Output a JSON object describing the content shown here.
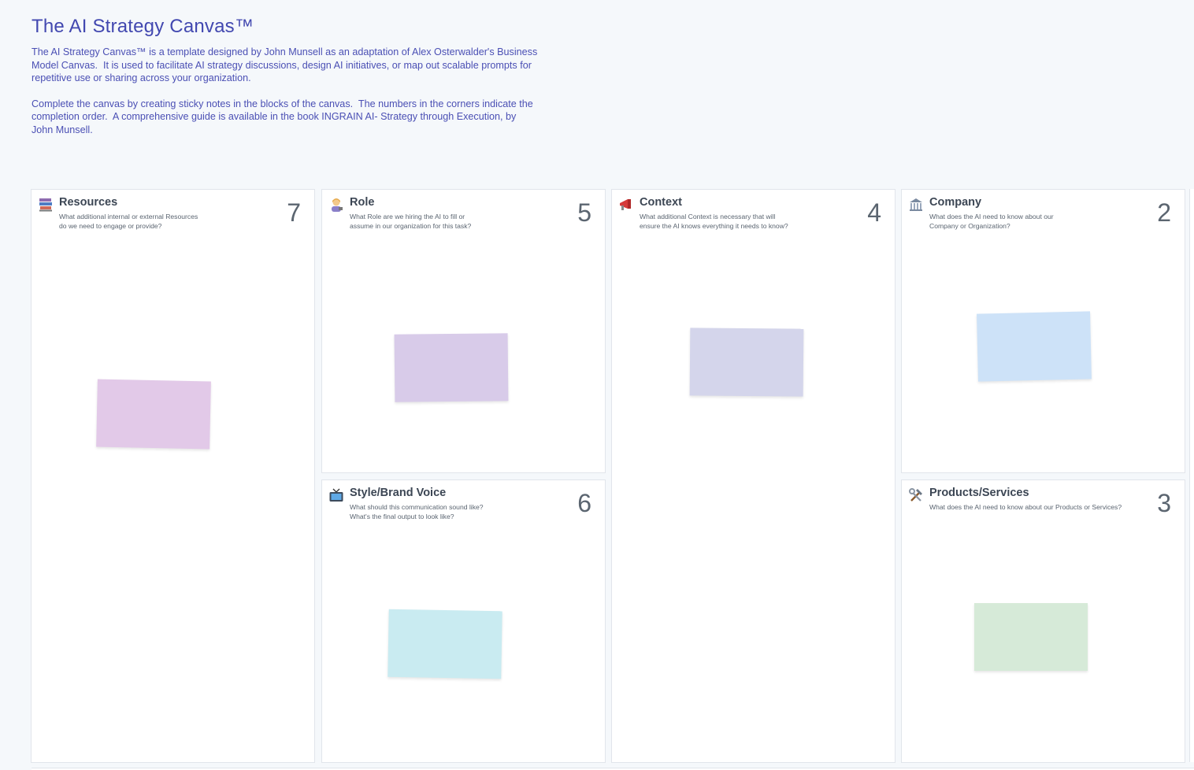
{
  "header": {
    "title": "The AI Strategy Canvas™",
    "paragraph1": "The AI Strategy Canvas™ is a template designed by John Munsell as an adaptation of Alex Osterwalder's Business\nModel Canvas.  It is used to facilitate AI strategy discussions, design AI initiatives, or map out scalable prompts for\nrepetitive use or sharing across your organization.",
    "paragraph2": "Complete the canvas by creating sticky notes in the blocks of the canvas.  The numbers in the corners indicate the\ncompletion order.  A comprehensive guide is available in the book INGRAIN AI- Strategy through Execution, by\nJohn Munsell."
  },
  "blocks": {
    "resources": {
      "title": "Resources",
      "question": "What additional internal or external Resources\ndo we need to engage or provide?",
      "number": "7",
      "icon": "books-icon",
      "note_color": "#e2c9e8"
    },
    "role": {
      "title": "Role",
      "question": "What Role are we hiring the AI to fill or\nassume in our organization for this task?",
      "number": "5",
      "icon": "person-icon",
      "note_color": "#d8cbe9"
    },
    "style": {
      "title": "Style/Brand Voice",
      "question": "What should this communication sound like?\nWhat's the final output to look like?",
      "number": "6",
      "icon": "television-icon",
      "note_color": "#c9ebf1"
    },
    "context": {
      "title": "Context",
      "question": "What additional Context is necessary that will\nensure the AI knows everything it needs to know?",
      "number": "4",
      "icon": "megaphone-icon",
      "note_color": "#d4d5eb"
    },
    "company": {
      "title": "Company",
      "question": "What does the AI need to know about our\nCompany or Organization?",
      "number": "2",
      "icon": "building-icon",
      "note_color": "#cde2f8"
    },
    "products": {
      "title": "Products/Services",
      "question": "What does the AI need to know about our Products or Services?",
      "number": "3",
      "icon": "tools-icon",
      "note_color": "#d6ead8"
    }
  }
}
